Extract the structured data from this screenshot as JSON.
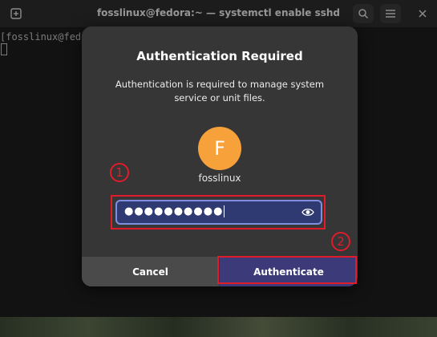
{
  "terminal": {
    "title": "fosslinux@fedora:~ — systemctl enable sshd",
    "prompt": "[fosslinux@fedo",
    "icons": {
      "new_tab": "new-tab-icon",
      "search": "search-icon",
      "menu": "hamburger-menu-icon",
      "close": "close-icon"
    }
  },
  "dialog": {
    "title": "Authentication Required",
    "message": "Authentication is required to manage system service or unit files.",
    "avatar_initial": "F",
    "avatar_color": "#f7a13a",
    "username": "fosslinux",
    "password_masked": "●●●●●●●●●●",
    "password_icon": "eye-icon",
    "cancel_label": "Cancel",
    "authenticate_label": "Authenticate",
    "accent_color": "#3d3a7a"
  },
  "annotations": {
    "step1": "1",
    "step2": "2",
    "highlight_color": "#e01b2a"
  }
}
